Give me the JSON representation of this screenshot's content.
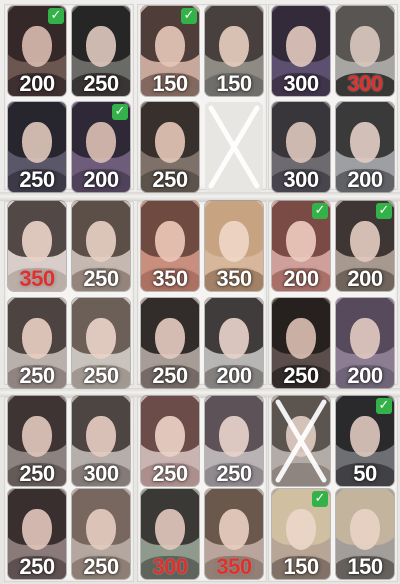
{
  "cards": [
    {
      "price": "200",
      "red": false,
      "check": true,
      "crossed": false,
      "colors": [
        "#6b5650",
        "#2b2022",
        "#d7b9ac",
        "#3a2c2e"
      ]
    },
    {
      "price": "250",
      "red": false,
      "check": false,
      "crossed": false,
      "colors": [
        "#6a6a66",
        "#1b1a1b",
        "#dcc6bc",
        "#34302f"
      ]
    },
    {
      "price": "150",
      "red": false,
      "check": true,
      "crossed": false,
      "colors": [
        "#c9a89c",
        "#3a2a28",
        "#e4c5b6",
        "#7a6058"
      ]
    },
    {
      "price": "150",
      "red": false,
      "check": false,
      "crossed": false,
      "colors": [
        "#8e8a84",
        "#3b3331",
        "#e5cbbd",
        "#6d6a67"
      ]
    },
    {
      "price": "300",
      "red": false,
      "check": false,
      "crossed": false,
      "colors": [
        "#5d4f70",
        "#2c2430",
        "#e0c6bd",
        "#3d3147"
      ]
    },
    {
      "price": "300",
      "red": true,
      "check": false,
      "crossed": false,
      "colors": [
        "#a8a6a3",
        "#4a4745",
        "#d8c7be",
        "#2c2b2a"
      ]
    },
    {
      "price": "250",
      "red": false,
      "check": false,
      "crossed": false,
      "colors": [
        "#5a5768",
        "#1e1d24",
        "#dcc3b8",
        "#3a3744"
      ]
    },
    {
      "price": "200",
      "red": false,
      "check": true,
      "crossed": false,
      "colors": [
        "#6d5c7a",
        "#241f2b",
        "#d9bdb2",
        "#4b3f57"
      ]
    },
    {
      "price": "250",
      "red": false,
      "check": false,
      "crossed": false,
      "colors": [
        "#7e716a",
        "#2b2422",
        "#e2c4b5",
        "#595049"
      ]
    },
    {
      "price": "",
      "red": false,
      "check": false,
      "crossed": true,
      "colors": [
        "#e8e6e2",
        "#e8e6e2",
        "#e8e6e2",
        "#e8e6e2"
      ]
    },
    {
      "price": "300",
      "red": false,
      "check": false,
      "crossed": false,
      "colors": [
        "#6d6a70",
        "#2f2c31",
        "#dac4bb",
        "#45414a"
      ]
    },
    {
      "price": "200",
      "red": false,
      "check": false,
      "crossed": false,
      "colors": [
        "#9d9fa3",
        "#2a2829",
        "#e0cbc2",
        "#5b5b5e"
      ]
    },
    {
      "price": "350",
      "red": true,
      "check": false,
      "crossed": false,
      "colors": [
        "#d8cdc8",
        "#3b302e",
        "#e9d2c7",
        "#b8aaa4"
      ]
    },
    {
      "price": "250",
      "red": false,
      "check": false,
      "crossed": false,
      "colors": [
        "#c4b8b0",
        "#4a3c36",
        "#e6cfc3",
        "#8f7e75"
      ]
    },
    {
      "price": "350",
      "red": false,
      "check": false,
      "crossed": false,
      "colors": [
        "#c98f7e",
        "#5e3e35",
        "#ecc6b6",
        "#a86e60"
      ]
    },
    {
      "price": "350",
      "red": false,
      "check": false,
      "crossed": false,
      "colors": [
        "#d7b79c",
        "#c6a07e",
        "#efd7c7",
        "#9d7b60"
      ]
    },
    {
      "price": "200",
      "red": false,
      "check": true,
      "crossed": false,
      "colors": [
        "#cf9f9a",
        "#6b3b36",
        "#eccabd",
        "#a36a63"
      ]
    },
    {
      "price": "200",
      "red": false,
      "check": true,
      "crossed": false,
      "colors": [
        "#a7998f",
        "#2b2524",
        "#e1c9bd",
        "#6a5f57"
      ]
    },
    {
      "price": "250",
      "red": false,
      "check": false,
      "crossed": false,
      "colors": [
        "#b9b0ab",
        "#3a302d",
        "#e6cdc1",
        "#8b807b"
      ]
    },
    {
      "price": "250",
      "red": false,
      "check": false,
      "crossed": false,
      "colors": [
        "#c9c3bd",
        "#5a4e47",
        "#e9d3c7",
        "#9c938c"
      ]
    },
    {
      "price": "250",
      "red": false,
      "check": false,
      "crossed": false,
      "colors": [
        "#a89c97",
        "#1d1918",
        "#e3c9be",
        "#6f6560"
      ]
    },
    {
      "price": "200",
      "red": false,
      "check": false,
      "crossed": false,
      "colors": [
        "#b8b6b4",
        "#2a2726",
        "#e6d1c9",
        "#7d7a78"
      ]
    },
    {
      "price": "250",
      "red": false,
      "check": false,
      "crossed": false,
      "colors": [
        "#5a4d4a",
        "#1d1918",
        "#d7bcb0",
        "#2e2827"
      ]
    },
    {
      "price": "200",
      "red": false,
      "check": false,
      "crossed": false,
      "colors": [
        "#8c7d92",
        "#4d4153",
        "#dfc7c0",
        "#6d6275"
      ]
    },
    {
      "price": "250",
      "red": false,
      "check": false,
      "crossed": false,
      "colors": [
        "#8c8280",
        "#2f2726",
        "#dfc5bb",
        "#5f5553"
      ]
    },
    {
      "price": "300",
      "red": false,
      "check": false,
      "crossed": false,
      "colors": [
        "#b5aeaa",
        "#3a3330",
        "#e4cbc0",
        "#7e7672"
      ]
    },
    {
      "price": "250",
      "red": false,
      "check": false,
      "crossed": false,
      "colors": [
        "#c9b4b2",
        "#5b3a36",
        "#ecd0c6",
        "#a98b88"
      ]
    },
    {
      "price": "250",
      "red": false,
      "check": false,
      "crossed": false,
      "colors": [
        "#b9b3b6",
        "#4b4146",
        "#e8d2ca",
        "#8c858a"
      ]
    },
    {
      "price": "",
      "red": false,
      "check": false,
      "crossed": true,
      "colors": [
        "#b3aca6",
        "#4c4440",
        "#decbc1",
        "#8a817c"
      ]
    },
    {
      "price": "50",
      "red": false,
      "check": true,
      "crossed": false,
      "colors": [
        "#6d6f72",
        "#1e1d1f",
        "#dbc6bc",
        "#3c3c40"
      ]
    },
    {
      "price": "250",
      "red": false,
      "check": false,
      "crossed": false,
      "colors": [
        "#8a7a7a",
        "#2b2222",
        "#dec3b8",
        "#5a4d4d"
      ]
    },
    {
      "price": "250",
      "red": false,
      "check": false,
      "crossed": false,
      "colors": [
        "#b4a7a0",
        "#6c5c53",
        "#e4cbbf",
        "#8a7a70"
      ]
    },
    {
      "price": "300",
      "red": true,
      "check": false,
      "crossed": false,
      "colors": [
        "#8f9a8c",
        "#2b2826",
        "#dfc6bb",
        "#5a5f57"
      ]
    },
    {
      "price": "350",
      "red": true,
      "check": false,
      "crossed": false,
      "colors": [
        "#b9a59b",
        "#5d4a40",
        "#e7cdbf",
        "#8e7b71"
      ]
    },
    {
      "price": "150",
      "red": false,
      "check": true,
      "crossed": false,
      "colors": [
        "#b7a695",
        "#d6c3a5",
        "#ecd6c8",
        "#7b6c60"
      ]
    },
    {
      "price": "150",
      "red": false,
      "check": false,
      "crossed": false,
      "colors": [
        "#a39e9a",
        "#c9b79e",
        "#e8d2c5",
        "#5e5955"
      ]
    }
  ]
}
